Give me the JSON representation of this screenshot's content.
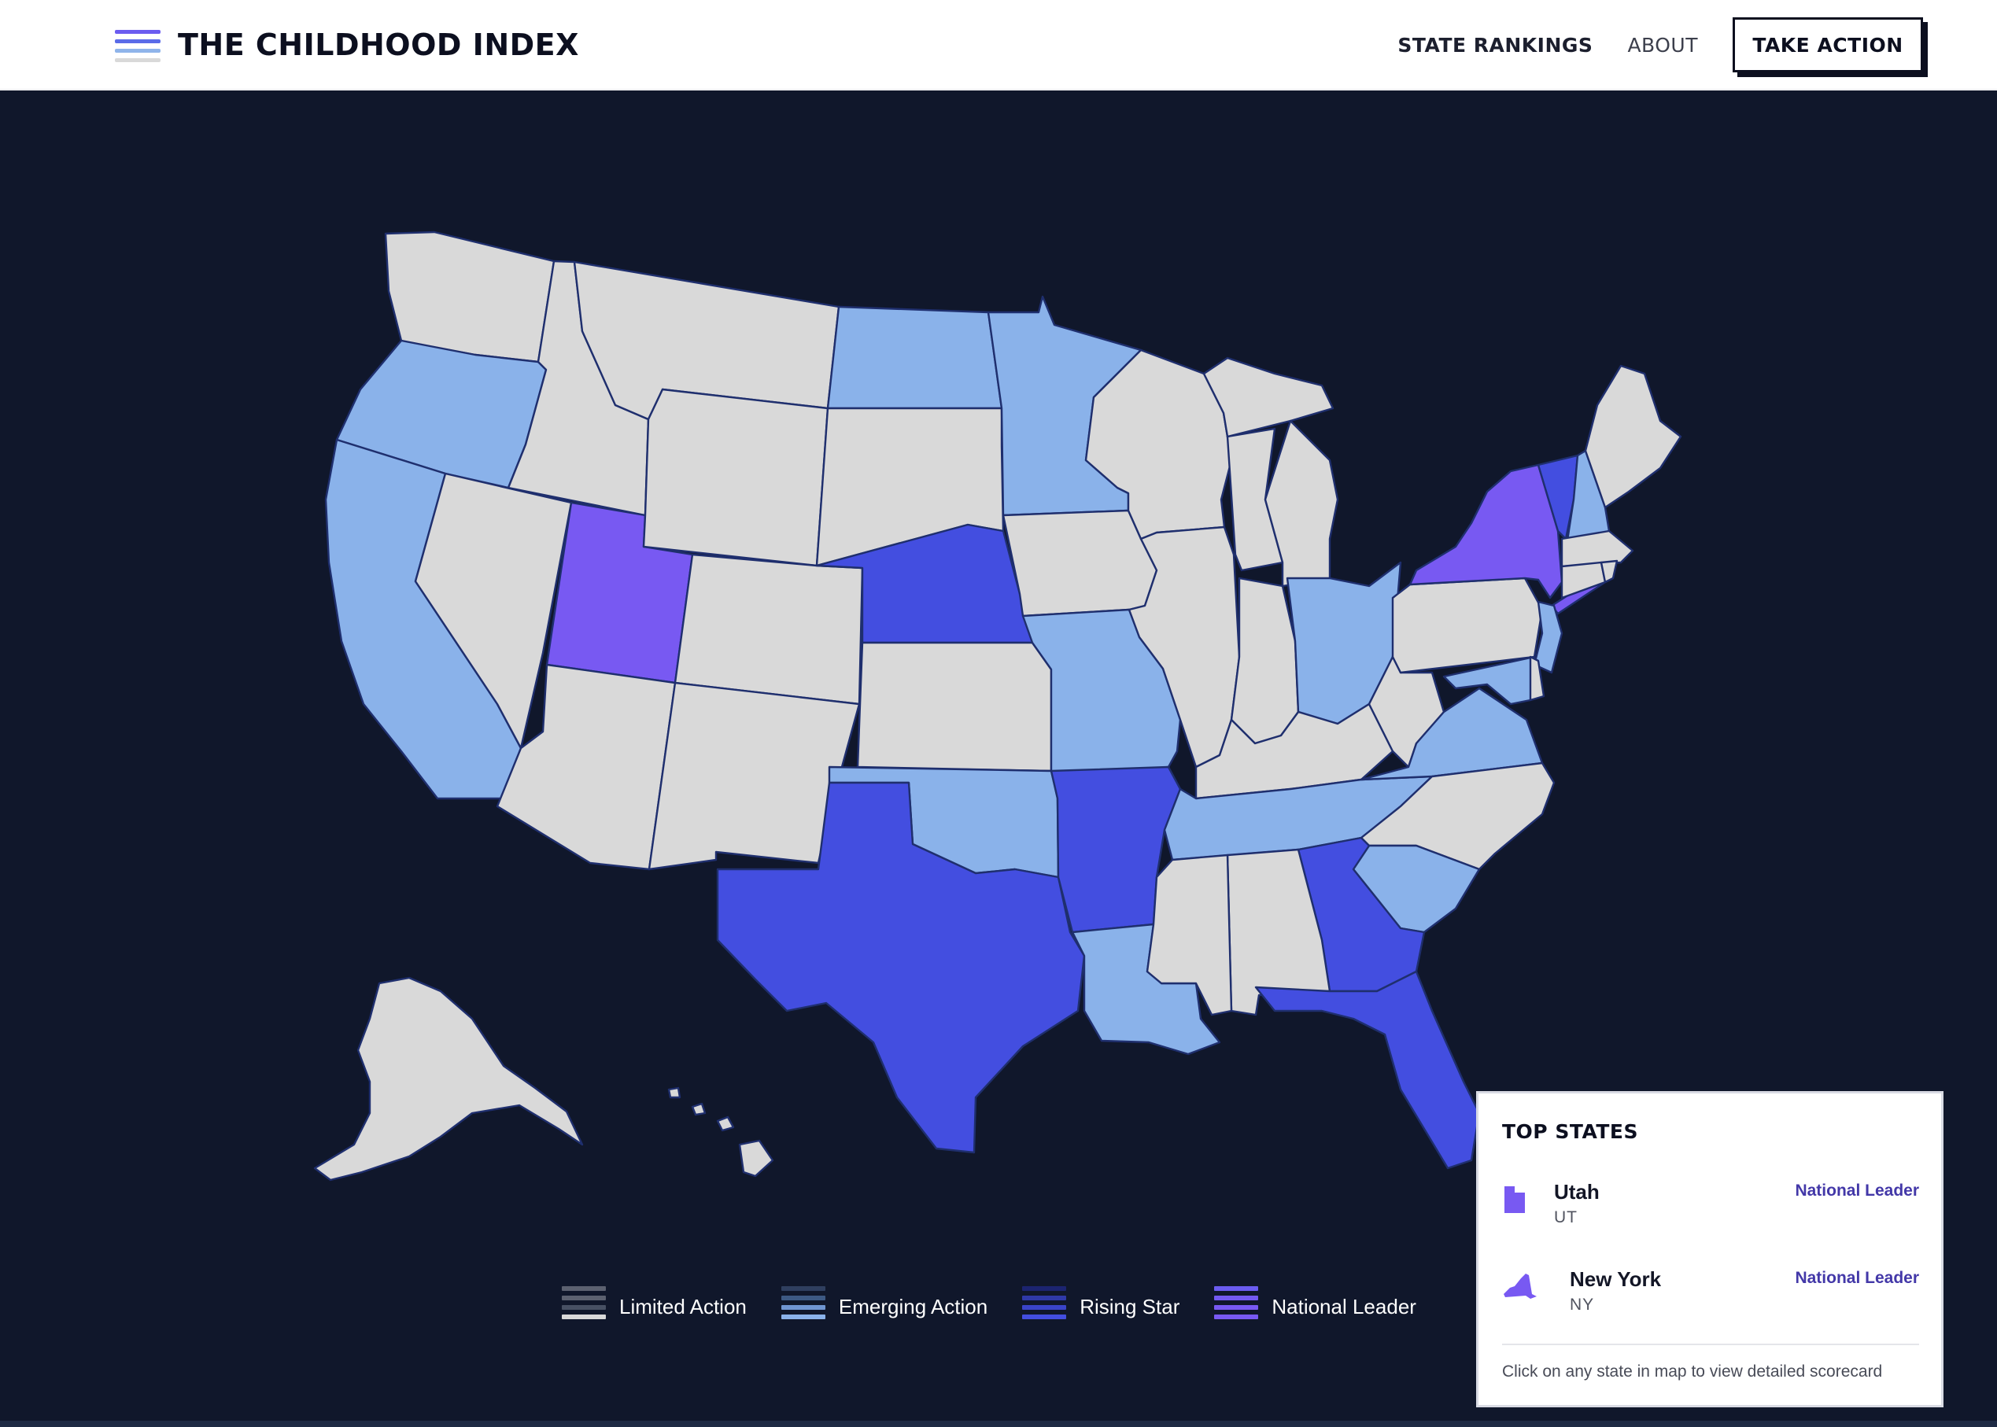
{
  "header": {
    "title": "THE CHILDHOOD INDEX",
    "nav": [
      {
        "label": "STATE RANKINGS"
      },
      {
        "label": "ABOUT"
      }
    ],
    "cta_label": "TAKE ACTION",
    "logo_colors": [
      "#6b5cf0",
      "#5a6be8",
      "#8fb4ea",
      "#d9d9d9"
    ]
  },
  "colors": {
    "map_background": "#10172b",
    "state_border": "#1f2f6e",
    "limited_action": "#d9d9d9",
    "emerging_action": "#8ab2ea",
    "rising_star": "#434ee0",
    "national_leader": "#7859f2"
  },
  "map": {
    "tiers": {
      "limited_action": [
        "WA",
        "ID",
        "MT",
        "NV",
        "WY",
        "SD",
        "CO",
        "KS",
        "AZ",
        "NM",
        "IA",
        "WI",
        "IL",
        "MI",
        "IN",
        "KY",
        "WV",
        "PA",
        "MS",
        "AL",
        "NC",
        "ME",
        "MA",
        "CT",
        "RI",
        "DE",
        "AK",
        "HI"
      ],
      "emerging_action": [
        "OR",
        "CA",
        "ND",
        "MN",
        "MO",
        "OK",
        "LA",
        "TN",
        "OH",
        "VA",
        "MD",
        "NJ",
        "SC",
        "NH"
      ],
      "rising_star": [
        "NE",
        "TX",
        "AR",
        "GA",
        "FL",
        "VT"
      ],
      "national_leader": [
        "UT",
        "NY"
      ]
    }
  },
  "legend": [
    {
      "label": "Limited Action",
      "colors": [
        "#5c6170",
        "#475063",
        "#d9d9d9"
      ]
    },
    {
      "label": "Emerging Action",
      "colors": [
        "#2f3f5f",
        "#3d5983",
        "#8ab2ea"
      ]
    },
    {
      "label": "Rising Star",
      "colors": [
        "#1c2470",
        "#2f39a8",
        "#434ee0"
      ]
    },
    {
      "label": "National Leader",
      "colors": [
        "#6b5cf0",
        "#7359f0",
        "#7859f2"
      ]
    }
  ],
  "top_states": {
    "title": "TOP STATES",
    "items": [
      {
        "name": "Utah",
        "abbr": "UT",
        "tier": "National Leader",
        "icon": "utah-shape-icon"
      },
      {
        "name": "New York",
        "abbr": "NY",
        "tier": "National Leader",
        "icon": "new-york-shape-icon"
      }
    ],
    "hint": "Click on any state in map to view detailed scorecard"
  }
}
